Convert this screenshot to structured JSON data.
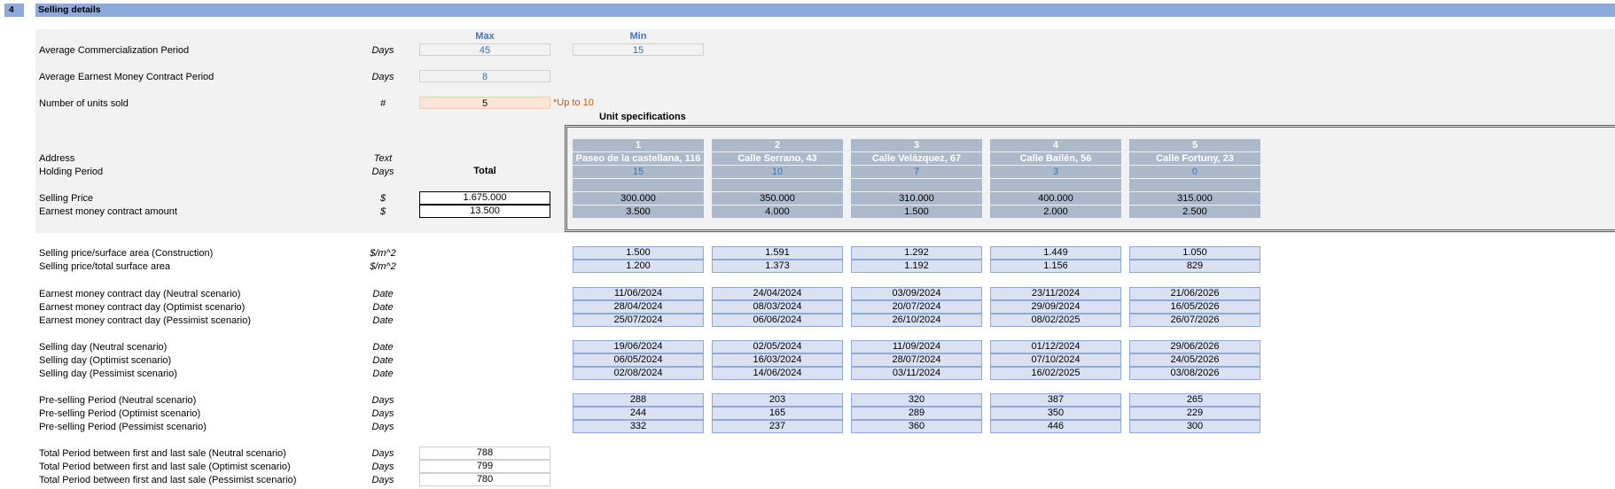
{
  "section": {
    "number": "4",
    "title": "Selling details"
  },
  "headers": {
    "max": "Max",
    "min": "Min",
    "total": "Total",
    "unit_specs": "Unit specifications"
  },
  "top_rows": [
    {
      "label": "Average Commercialization Period",
      "unit": "Days",
      "max": "45",
      "min": "15"
    },
    {
      "label": "Average Earnest Money Contract Period",
      "unit": "Days",
      "max": "8"
    },
    {
      "label": "Number of units sold",
      "unit": "#",
      "max": "5",
      "note": "*Up to 10"
    }
  ],
  "spec_labels": [
    {
      "label": "Address",
      "unit": "Text"
    },
    {
      "label": "Holding Period",
      "unit": "Days"
    },
    {
      "label": "Selling Price",
      "unit": "$",
      "total": "1.675.000"
    },
    {
      "label": "Earnest money contract amount",
      "unit": "$",
      "total": "13.500"
    }
  ],
  "units": [
    {
      "num": "1",
      "address": "Paseo de la castellana, 116",
      "holding": "15",
      "price": "300.000",
      "earnest": "3.500"
    },
    {
      "num": "2",
      "address": "Calle Serrano, 43",
      "holding": "10",
      "price": "350.000",
      "earnest": "4.000"
    },
    {
      "num": "3",
      "address": "Calle Velázquez, 67",
      "holding": "7",
      "price": "310.000",
      "earnest": "1.500"
    },
    {
      "num": "4",
      "address": "Calle Bailén, 56",
      "holding": "3",
      "price": "400.000",
      "earnest": "2.000"
    },
    {
      "num": "5",
      "address": "Calle Fortuny, 23",
      "holding": "0",
      "price": "315.000",
      "earnest": "2.500"
    }
  ],
  "groups": [
    {
      "rows": [
        {
          "label": "Selling price/surface area (Construction)",
          "unit": "$/m^2",
          "values": [
            "1.500",
            "1.591",
            "1.292",
            "1.449",
            "1.050"
          ]
        },
        {
          "label": "Selling price/total surface area",
          "unit": "$/m^2",
          "values": [
            "1.200",
            "1.373",
            "1.192",
            "1.156",
            "829"
          ]
        }
      ]
    },
    {
      "rows": [
        {
          "label": "Earnest money contract day (Neutral scenario)",
          "unit": "Date",
          "values": [
            "11/06/2024",
            "24/04/2024",
            "03/09/2024",
            "23/11/2024",
            "21/06/2026"
          ]
        },
        {
          "label": "Earnest money contract day (Optimist scenario)",
          "unit": "Date",
          "values": [
            "28/04/2024",
            "08/03/2024",
            "20/07/2024",
            "29/09/2024",
            "16/05/2026"
          ]
        },
        {
          "label": "Earnest money contract day (Pessimist scenario)",
          "unit": "Date",
          "values": [
            "25/07/2024",
            "06/06/2024",
            "26/10/2024",
            "08/02/2025",
            "26/07/2026"
          ]
        }
      ]
    },
    {
      "rows": [
        {
          "label": "Selling day (Neutral scenario)",
          "unit": "Date",
          "values": [
            "19/06/2024",
            "02/05/2024",
            "11/09/2024",
            "01/12/2024",
            "29/06/2026"
          ]
        },
        {
          "label": "Selling day (Optimist scenario)",
          "unit": "Date",
          "values": [
            "06/05/2024",
            "16/03/2024",
            "28/07/2024",
            "07/10/2024",
            "24/05/2026"
          ]
        },
        {
          "label": "Selling day (Pessimist scenario)",
          "unit": "Date",
          "values": [
            "02/08/2024",
            "14/06/2024",
            "03/11/2024",
            "16/02/2025",
            "03/08/2026"
          ]
        }
      ]
    },
    {
      "rows": [
        {
          "label": "Pre-selling Period (Neutral scenario)",
          "unit": "Days",
          "values": [
            "288",
            "203",
            "320",
            "387",
            "265"
          ]
        },
        {
          "label": "Pre-selling Period (Optimist scenario)",
          "unit": "Days",
          "values": [
            "244",
            "165",
            "289",
            "350",
            "229"
          ]
        },
        {
          "label": "Pre-selling Period (Pessimist scenario)",
          "unit": "Days",
          "values": [
            "332",
            "237",
            "360",
            "446",
            "300"
          ]
        }
      ]
    }
  ],
  "totals": [
    {
      "label": "Total Period between first and last sale (Neutral scenario)",
      "unit": "Days",
      "value": "788"
    },
    {
      "label": "Total Period between first and last sale (Optimist scenario)",
      "unit": "Days",
      "value": "799"
    },
    {
      "label": "Total Period between first and last sale (Pessimist scenario)",
      "unit": "Days",
      "value": "780"
    }
  ]
}
